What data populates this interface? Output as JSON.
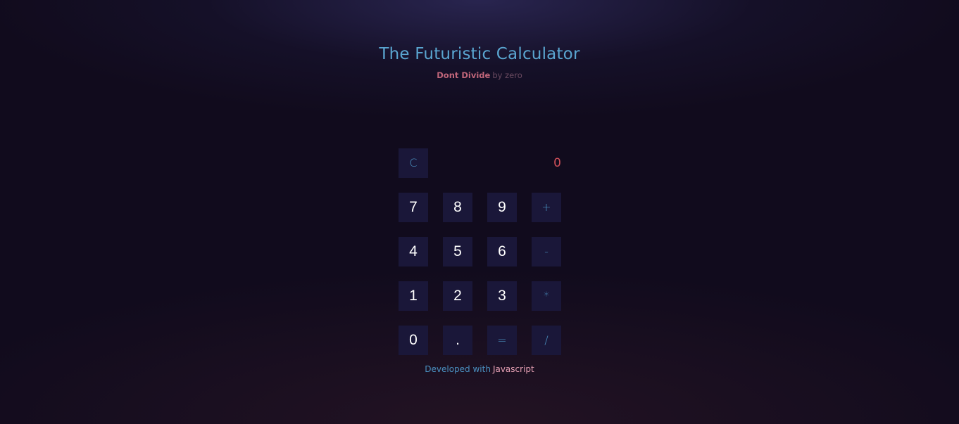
{
  "header": {
    "title": "The Futuristic Calculator",
    "subtitle_strong": "Dont Divide",
    "subtitle_rest": "by zero"
  },
  "calculator": {
    "clear_label": "C",
    "display_value": "0",
    "rows": [
      [
        "7",
        "8",
        "9",
        "+"
      ],
      [
        "4",
        "5",
        "6",
        "-"
      ],
      [
        "1",
        "2",
        "3",
        "*"
      ],
      [
        "0",
        ".",
        "=",
        "/"
      ]
    ]
  },
  "footer": {
    "text": "Developed with",
    "highlight": "Javascript"
  },
  "colors": {
    "title": "#5aa5d0",
    "subtitle_strong": "#c0667a",
    "subtitle_rest": "#6a4a60",
    "key_bg": "#1a1739",
    "digit_text": "#ffffff",
    "operator_text": "#4a90c0",
    "display_text": "#d2505a",
    "footer_text": "#4a90c0",
    "footer_highlight": "#e6a0b4"
  }
}
